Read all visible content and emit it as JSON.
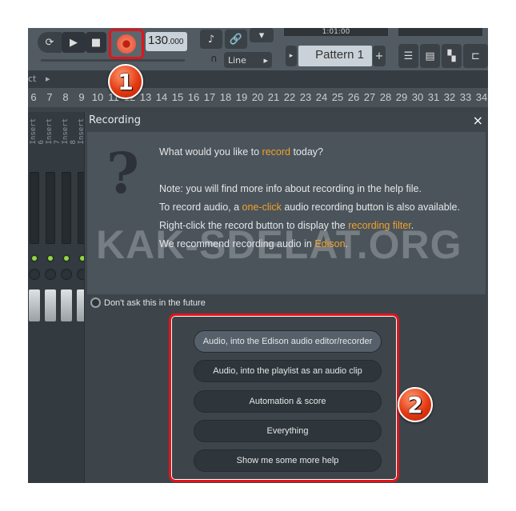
{
  "toolbar": {
    "tempo": "130",
    "tempo_decimals": ".000",
    "line_mode": "Line",
    "pattern": "Pattern 1",
    "pattern_add": "+",
    "time_display": "1:01:00"
  },
  "strip": {
    "label": "ct"
  },
  "ruler": {
    "bars": [
      "6",
      "7",
      "8",
      "9",
      "10",
      "11",
      "12",
      "13",
      "14",
      "15",
      "16",
      "17",
      "18",
      "19",
      "20",
      "21",
      "22",
      "23",
      "24",
      "25",
      "26",
      "27",
      "28",
      "29",
      "30",
      "31",
      "32",
      "33",
      "34"
    ]
  },
  "mixer": {
    "inserts": [
      "Insert 6",
      "Insert 7",
      "Insert 8",
      "Insert 9"
    ]
  },
  "dialog": {
    "title": "Recording",
    "close": "×",
    "question_mark": "?",
    "q_pre": "What would you like to ",
    "q_hl": "record",
    "q_post": " today?",
    "l1": "Note: you will find more info about recording in the help file.",
    "l2_pre": "To record audio, a ",
    "l2_hl": "one-click",
    "l2_post": " audio recording button is also available.",
    "l3_pre": "Right-click the record button to display the ",
    "l3_hl": "recording filter",
    "l3_post": ".",
    "l4_pre": "We recommend recording audio in ",
    "l4_hl": "Edison",
    "l4_post": ".",
    "dont_ask": "Don't ask this in the future",
    "options": [
      "Audio, into the Edison audio editor/recorder",
      "Audio, into the playlist as an audio clip",
      "Automation & score",
      "Everything",
      "Show me some more help"
    ]
  },
  "watermark": "KAK-SDELAT.ORG",
  "badges": {
    "one": "1",
    "two": "2"
  },
  "colors": {
    "highlight": "#f2a12a",
    "annotation": "#e0151b",
    "record": "#e8553a"
  }
}
